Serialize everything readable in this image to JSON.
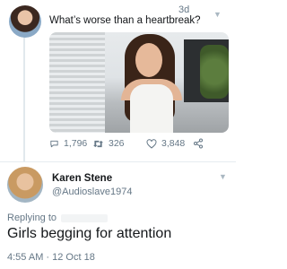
{
  "original_tweet": {
    "time": "3d",
    "text": "What’s worse than a heartbreak?",
    "actions": {
      "reply_count": "1,796",
      "retweet_count": "326",
      "like_count": "3,848"
    }
  },
  "reply_tweet": {
    "display_name": "Karen Stene",
    "handle": "@Audioslave1974",
    "replying_to_label": "Replying to",
    "text": "Girls begging for attention",
    "timestamp": "4:55 AM · 12 Oct 18"
  },
  "colors": {
    "text_primary": "#14171a",
    "text_secondary": "#657786",
    "divider": "#e6ecf0"
  }
}
